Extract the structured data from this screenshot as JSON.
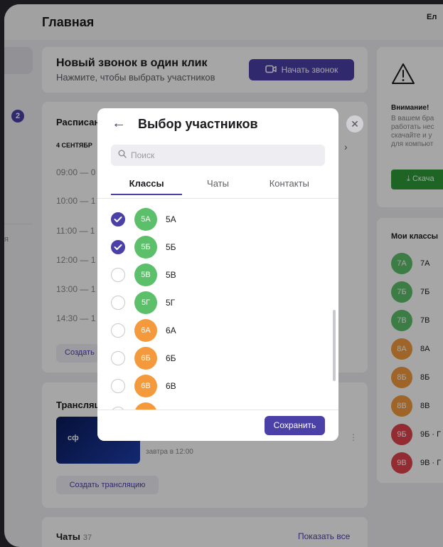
{
  "header": {
    "title": "Главная",
    "user": "Ел"
  },
  "sidebar": {
    "badge": "2",
    "text": "я"
  },
  "call_card": {
    "title": "Новый звонок в один клик",
    "subtitle": "Нажмите, чтобы выбрать участников",
    "button": "Начать звонок"
  },
  "schedule": {
    "title": "Расписан",
    "date": "4 СЕНТЯБР",
    "times": [
      "09:00 — 0",
      "10:00 — 1",
      "11:00 — 1",
      "12:00 — 1",
      "13:00 — 1",
      "14:30 — 1"
    ],
    "create_button": "Создать"
  },
  "broadcast": {
    "title": "Трансляц",
    "thumb_text": "сф",
    "item_subtitle": "завтра в 12:00",
    "create_button": "Создать трансляцию"
  },
  "chats": {
    "title": "Чаты",
    "count": "37",
    "show_all": "Показать все"
  },
  "warning": {
    "title": "Внимание!",
    "lines": [
      "В вашем бра",
      "работать нес",
      "скачайте и у",
      "для компьют"
    ],
    "button": "Скача"
  },
  "my_classes": {
    "title": "Мои классы",
    "items": [
      {
        "avatar": "7А",
        "label": "7А",
        "color": "#5cbf6a"
      },
      {
        "avatar": "7Б",
        "label": "7Б",
        "color": "#5cbf6a"
      },
      {
        "avatar": "7В",
        "label": "7В",
        "color": "#5cbf6a"
      },
      {
        "avatar": "8А",
        "label": "8А",
        "color": "#f59a3c"
      },
      {
        "avatar": "8Б",
        "label": "8Б",
        "color": "#f59a3c"
      },
      {
        "avatar": "8В",
        "label": "8В",
        "color": "#f59a3c"
      },
      {
        "avatar": "9Б",
        "label": "9Б · Г",
        "color": "#e0434d"
      },
      {
        "avatar": "9В",
        "label": "9В · Г",
        "color": "#e0434d"
      }
    ]
  },
  "modal": {
    "title": "Выбор участников",
    "search_placeholder": "Поиск",
    "tabs": [
      "Классы",
      "Чаты",
      "Контакты"
    ],
    "active_tab": "Классы",
    "items": [
      {
        "avatar": "5А",
        "label": "5А",
        "checked": true,
        "color": "#5cbf6a"
      },
      {
        "avatar": "5Б",
        "label": "5Б",
        "checked": true,
        "color": "#5cbf6a"
      },
      {
        "avatar": "5В",
        "label": "5В",
        "checked": false,
        "color": "#5cbf6a"
      },
      {
        "avatar": "5Г",
        "label": "5Г",
        "checked": false,
        "color": "#5cbf6a"
      },
      {
        "avatar": "6А",
        "label": "6А",
        "checked": false,
        "color": "#f59a3c"
      },
      {
        "avatar": "6Б",
        "label": "6Б",
        "checked": false,
        "color": "#f59a3c"
      },
      {
        "avatar": "6В",
        "label": "6В",
        "checked": false,
        "color": "#f59a3c"
      }
    ],
    "save_button": "Сохранить"
  },
  "colors": {
    "accent": "#4b3fa8",
    "green": "#5cbf6a",
    "orange": "#f59a3c",
    "red": "#e0434d",
    "download": "#2e9a3a"
  }
}
